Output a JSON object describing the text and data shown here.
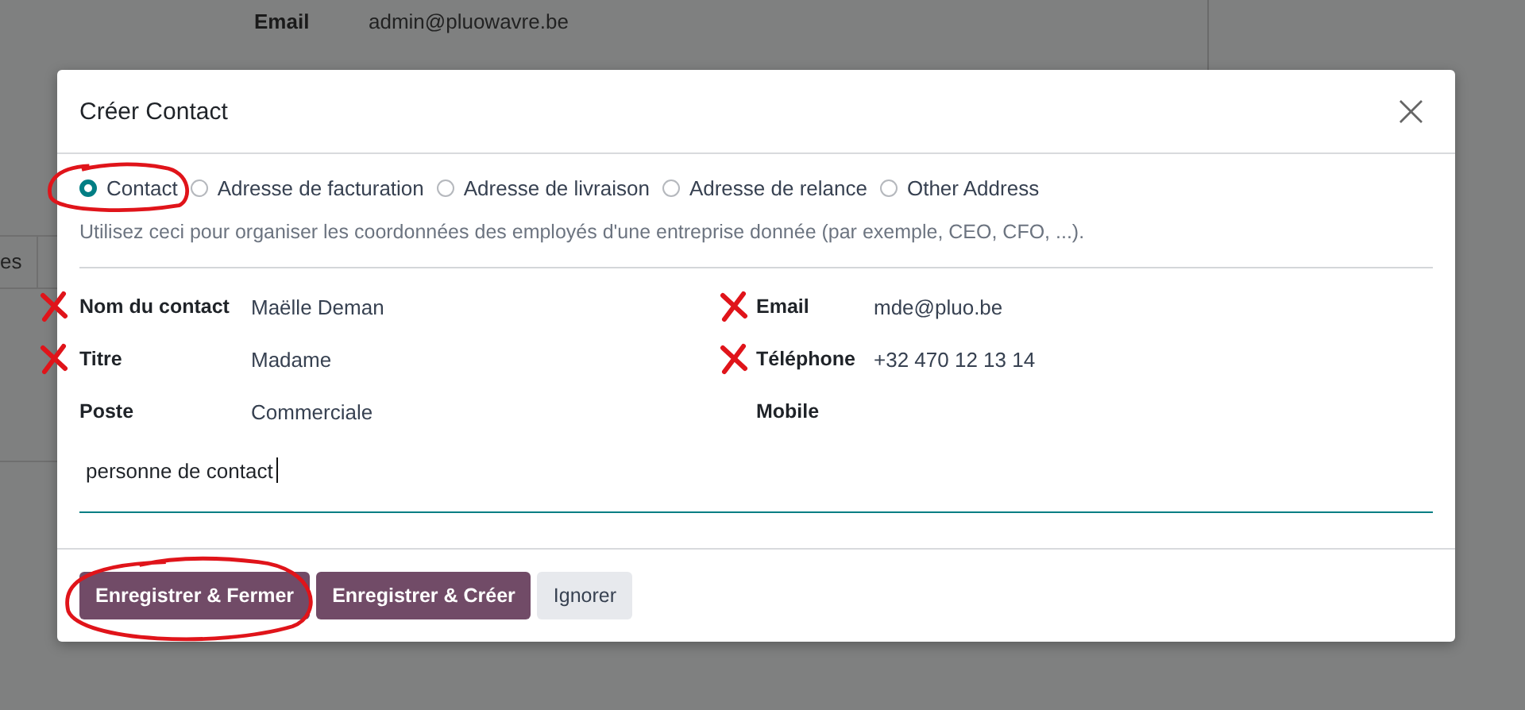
{
  "background": {
    "email_label": "Email",
    "email_value": "admin@pluowavre.be",
    "column_fragment": "es"
  },
  "dialog": {
    "title": "Créer Contact",
    "close": "×",
    "address_types": [
      {
        "label": "Contact",
        "selected": true,
        "circled": true
      },
      {
        "label": "Adresse de facturation",
        "selected": false,
        "circled": false
      },
      {
        "label": "Adresse de livraison",
        "selected": false,
        "circled": false
      },
      {
        "label": "Adresse de relance",
        "selected": false,
        "circled": false
      },
      {
        "label": "Other Address",
        "selected": false,
        "circled": false
      }
    ],
    "hint": "Utilisez ceci pour organiser les coordonnées des employés d'une entreprise donnée (par exemple, CEO, CFO, ...).",
    "fields_left": [
      {
        "label": "Nom du contact",
        "value": "Maëlle Deman",
        "marked": true
      },
      {
        "label": "Titre",
        "value": "Madame",
        "marked": true
      },
      {
        "label": "Poste",
        "value": "Commerciale",
        "marked": false
      }
    ],
    "fields_right": [
      {
        "label": "Email",
        "value": "mde@pluo.be",
        "marked": true
      },
      {
        "label": "Téléphone",
        "value": "+32 470 12 13 14",
        "marked": true
      },
      {
        "label": "Mobile",
        "marked": false
      }
    ],
    "notes": {
      "value": "personne de contact"
    },
    "buttons": [
      {
        "label": "Enregistrer & Fermer",
        "kind": "primary",
        "circled": true
      },
      {
        "label": "Enregistrer & Créer",
        "kind": "primary",
        "circled": false
      },
      {
        "label": "Ignorer",
        "kind": "secondary",
        "circled": false
      }
    ]
  }
}
